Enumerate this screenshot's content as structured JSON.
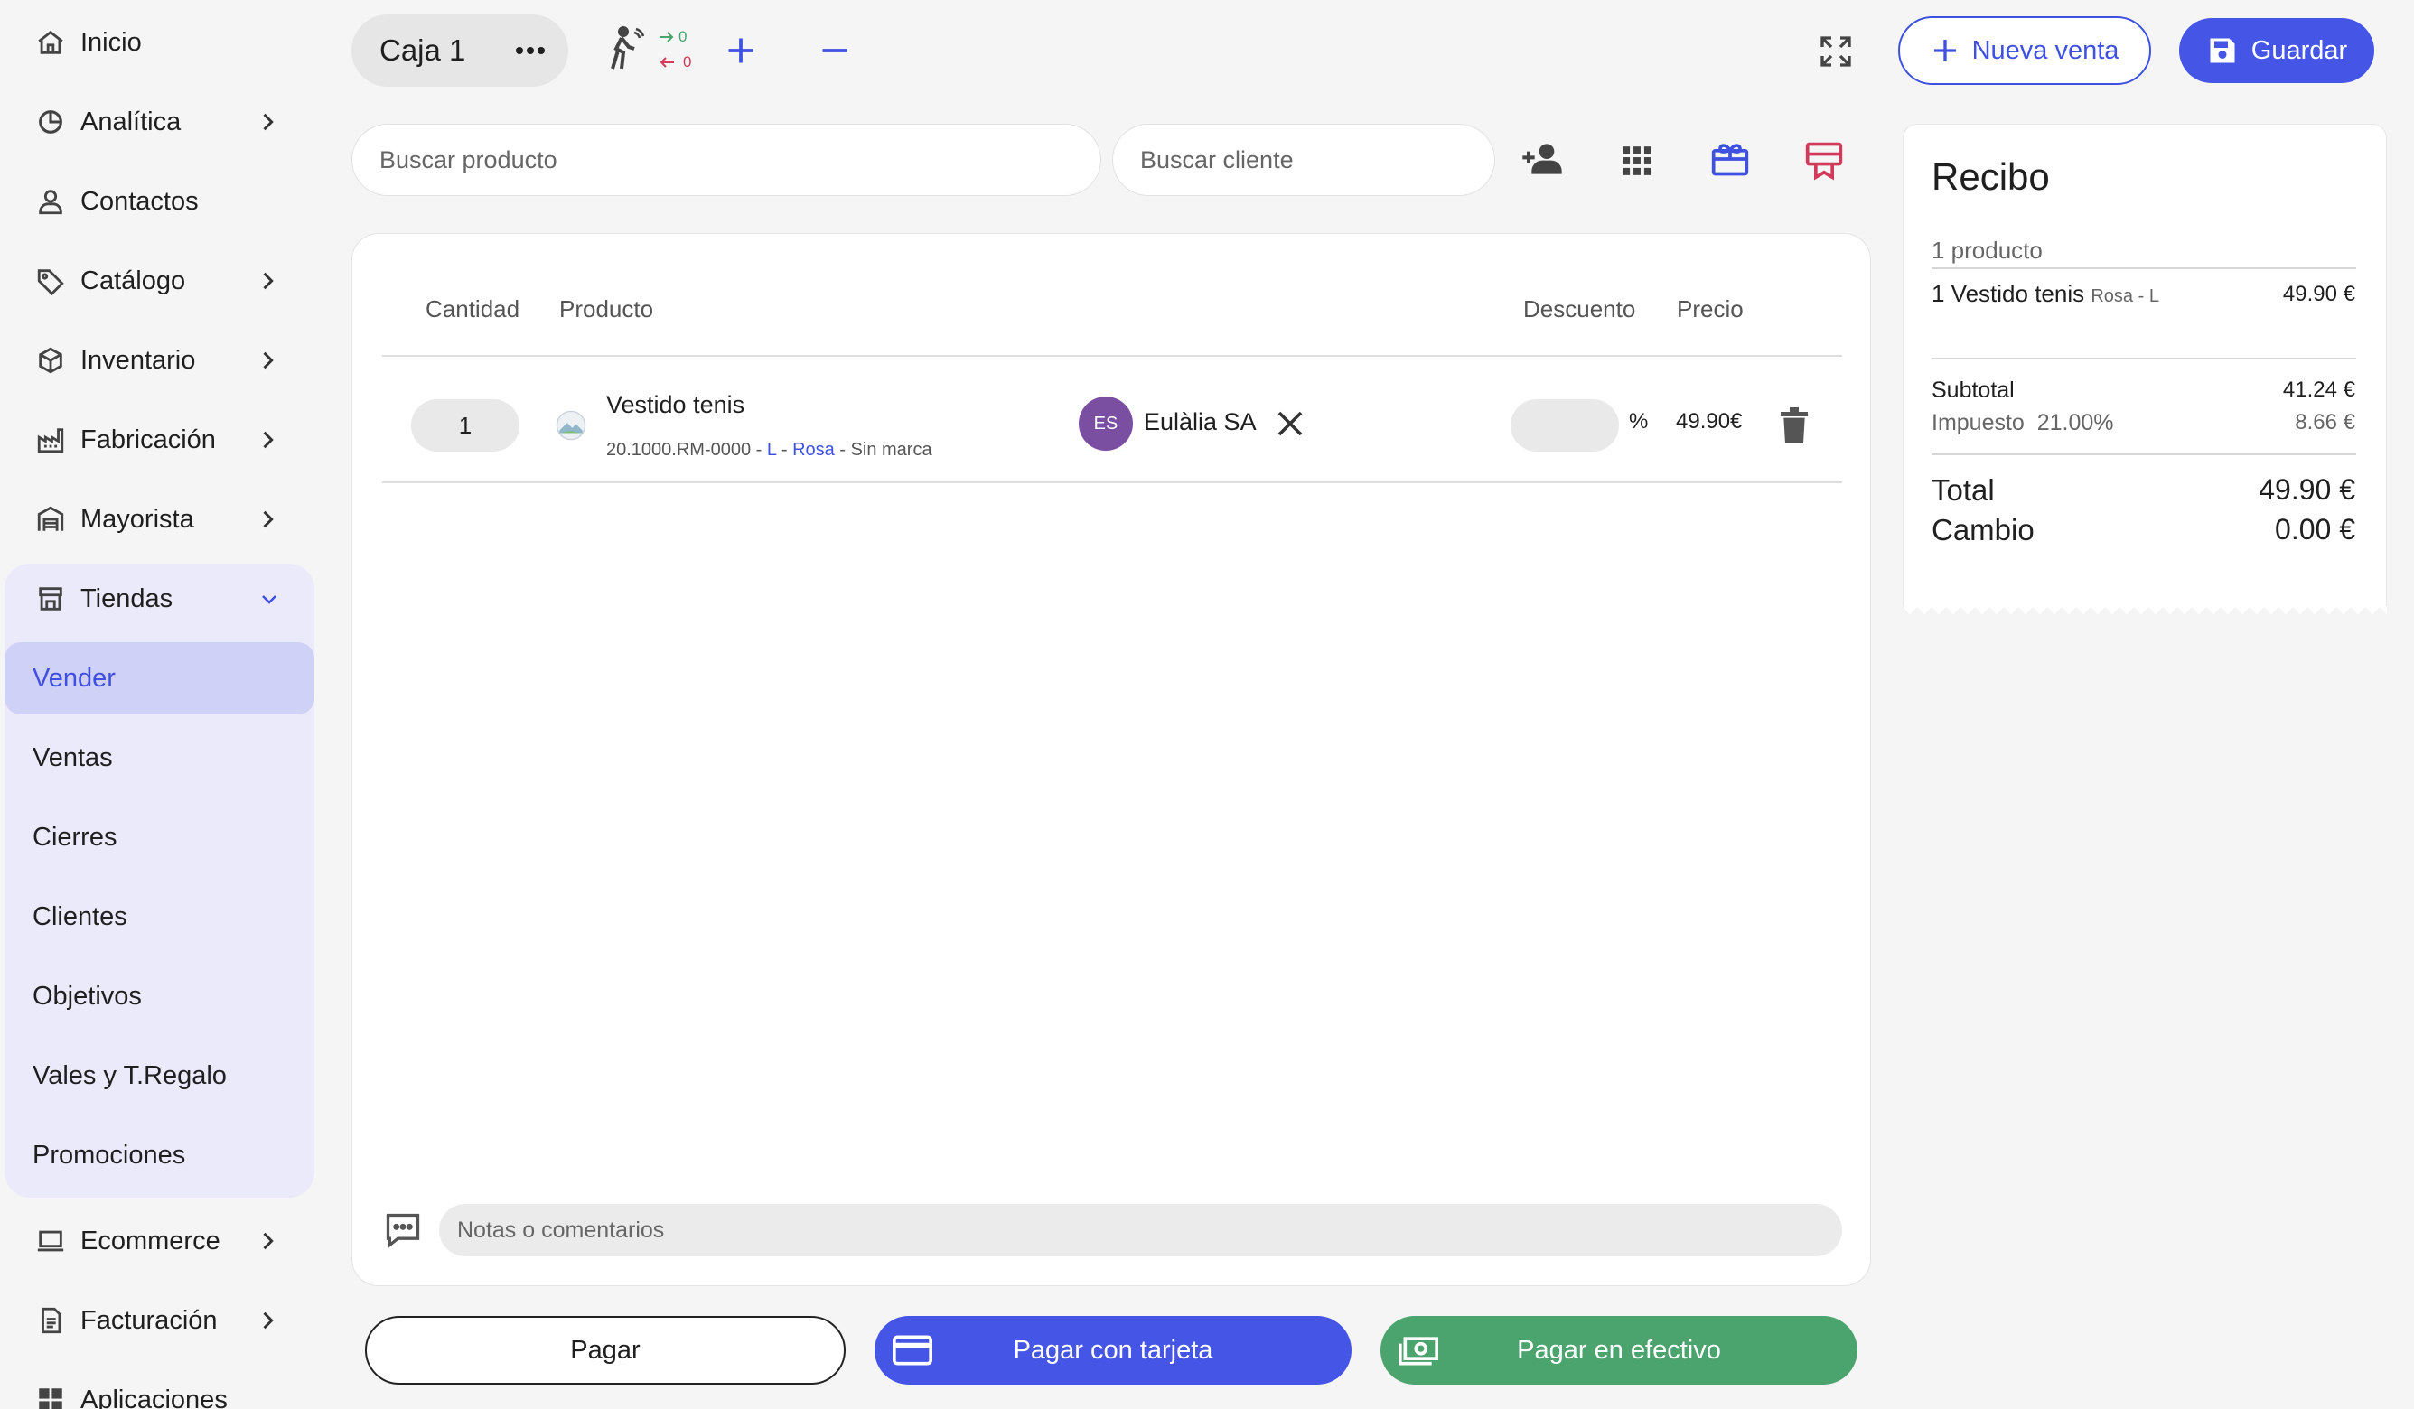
{
  "sidebar": {
    "items": [
      {
        "label": "Inicio",
        "icon": "home-icon"
      },
      {
        "label": "Analítica",
        "icon": "chart-pie-icon"
      },
      {
        "label": "Contactos",
        "icon": "person-icon"
      },
      {
        "label": "Catálogo",
        "icon": "tag-icon"
      },
      {
        "label": "Inventario",
        "icon": "box-icon"
      },
      {
        "label": "Fabricación",
        "icon": "factory-icon"
      },
      {
        "label": "Mayorista",
        "icon": "warehouse-icon"
      },
      {
        "label": "Tiendas",
        "icon": "store-icon"
      }
    ],
    "tiendas_sub": [
      "Vender",
      "Ventas",
      "Cierres",
      "Clientes",
      "Objetivos",
      "Vales y T.Regalo",
      "Promociones"
    ],
    "bottom_items": [
      {
        "label": "Ecommerce",
        "icon": "laptop-icon"
      },
      {
        "label": "Facturación",
        "icon": "document-icon"
      },
      {
        "label": "Aplicaciones",
        "icon": "apps-icon"
      }
    ]
  },
  "topbar": {
    "register": "Caja 1",
    "sync_out": "0",
    "sync_in": "0",
    "new_sale": "Nueva venta",
    "save": "Guardar"
  },
  "search": {
    "product_placeholder": "Buscar producto",
    "client_placeholder": "Buscar cliente"
  },
  "table": {
    "headers": {
      "qty": "Cantidad",
      "product": "Producto",
      "discount": "Descuento",
      "price": "Precio"
    },
    "rows": [
      {
        "qty": "1",
        "name": "Vestido tenis",
        "sku": "20.1000.RM-0000",
        "sep1": " - ",
        "size": "L",
        "sep2": " - ",
        "color": "Rosa",
        "sep3": " - ",
        "brand": "Sin marca",
        "client_initials": "ES",
        "client": "Eulàlia SA",
        "pct": "%",
        "price": "49.90€"
      }
    ]
  },
  "notes_placeholder": "Notas o comentarios",
  "pay": {
    "pay": "Pagar",
    "card": "Pagar con tarjeta",
    "cash": "Pagar en efectivo"
  },
  "receipt": {
    "title": "Recibo",
    "count": "1 producto",
    "item_name": "1 Vestido tenis",
    "item_variant": "Rosa - L",
    "item_price": "49.90 €",
    "subtotal_label": "Subtotal",
    "subtotal": "41.24 €",
    "tax_label": "Impuesto  21.00%",
    "tax": "8.66 €",
    "total_label": "Total",
    "total": "49.90 €",
    "change_label": "Cambio",
    "change": "0.00 €"
  },
  "colors": {
    "primary": "#4555e6",
    "cash": "#4ba36d",
    "accent_red": "#d13a5a",
    "active_bg": "#cfd1f7",
    "group_bg": "#ebeafb"
  }
}
